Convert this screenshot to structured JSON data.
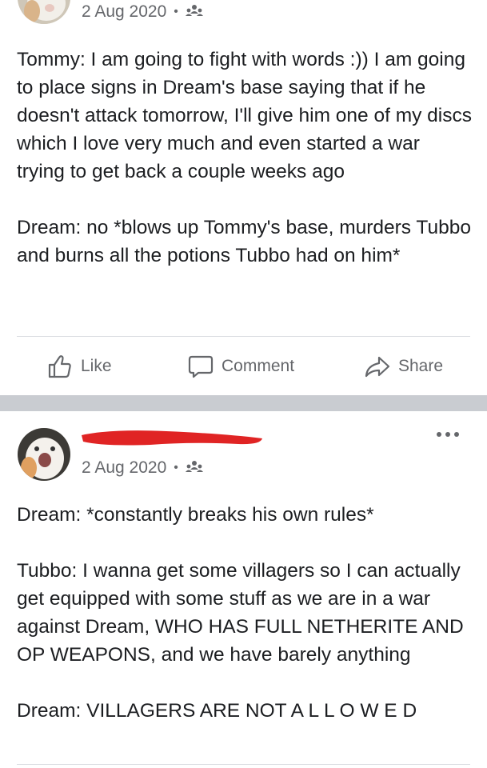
{
  "post1": {
    "date": "2 Aug 2020",
    "separator": "•",
    "privacy_icon": "friends-icon",
    "paragraphs": [
      "Tommy: I am going to fight with words :)) I am going to place signs in Dream's base saying that if he doesn't attack tomorrow, I'll give him one of my discs which I love very much and even started a war trying to get back a couple weeks ago",
      "Dream: no *blows up Tommy's base, murders Tubbo and burns all the potions Tubbo had on him*"
    ],
    "actions": {
      "like": "Like",
      "comment": "Comment",
      "share": "Share"
    }
  },
  "post2": {
    "date": "2 Aug 2020",
    "separator": "•",
    "privacy_icon": "friends-icon",
    "author_redacted": true,
    "paragraphs": [
      "Dream: *constantly breaks his own rules*",
      "Tubbo: I wanna get some villagers so I can actually get equipped with some stuff as we are in a war against Dream, WHO HAS FULL NETHERITE AND OP WEAPONS, and we have barely anything",
      "Dream: VILLAGERS ARE NOT A L L O W E D"
    ]
  },
  "colors": {
    "text": "#1c1e21",
    "secondary": "#65676b",
    "divider": "#c9ccd1",
    "redaction": "#e02424"
  }
}
